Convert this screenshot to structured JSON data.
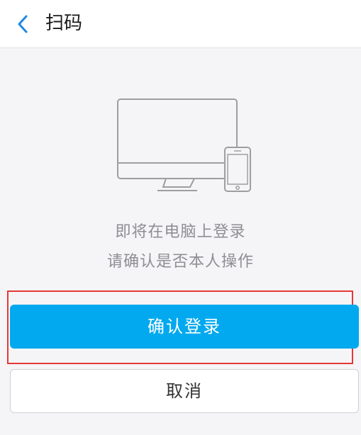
{
  "header": {
    "back_icon": "chevron-left-icon",
    "title": "扫码"
  },
  "illustration": {
    "icon": "desktop-and-phone-icon"
  },
  "message": {
    "line1": "即将在电脑上登录",
    "line2": "请确认是否本人操作"
  },
  "actions": {
    "confirm_label": "确认登录",
    "cancel_label": "取消"
  },
  "colors": {
    "accent": "#03a9ef",
    "highlight_box": "#e53935",
    "back_icon": "#1e88e5",
    "muted_text": "#8e8e93"
  }
}
